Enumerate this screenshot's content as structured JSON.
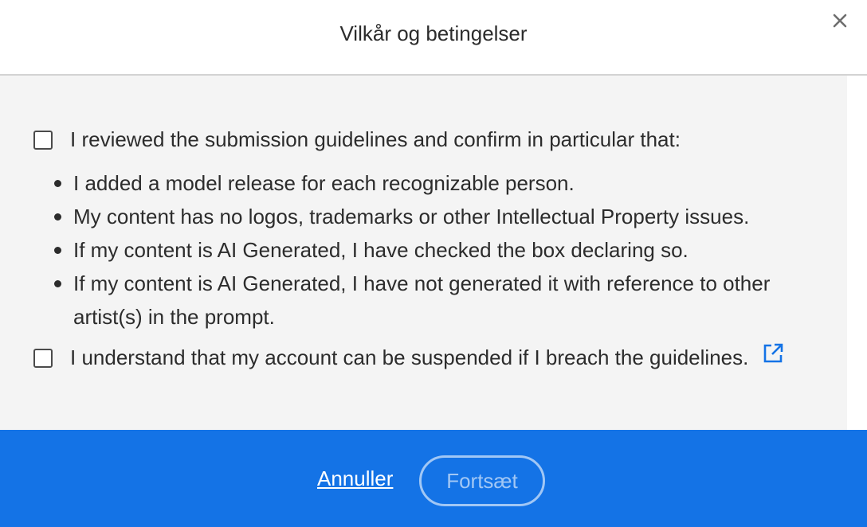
{
  "dialog": {
    "title": "Vilkår og betingelser",
    "close_icon": "close-icon"
  },
  "terms": {
    "guidelines_checkbox": {
      "label": "I reviewed the submission guidelines and confirm in particular that:",
      "checked": false
    },
    "points": [
      "I added a model release for each recognizable person.",
      "My content has no logos, trademarks or other Intellectual Property issues.",
      "If my content is AI Generated, I have checked the box declaring so.",
      "If my content is AI Generated, I have not generated it with reference to other artist(s) in the prompt."
    ],
    "suspension_checkbox": {
      "label": "I understand that my account can be suspended if I breach the guidelines.",
      "checked": false
    },
    "external_link_icon": "external-link-icon"
  },
  "footer": {
    "cancel_label": "Annuller",
    "continue_label": "Fortsæt",
    "continue_enabled": false
  },
  "colors": {
    "footer_background": "#1473e6",
    "link_icon": "#1473e6",
    "body_background": "#f4f4f4"
  }
}
